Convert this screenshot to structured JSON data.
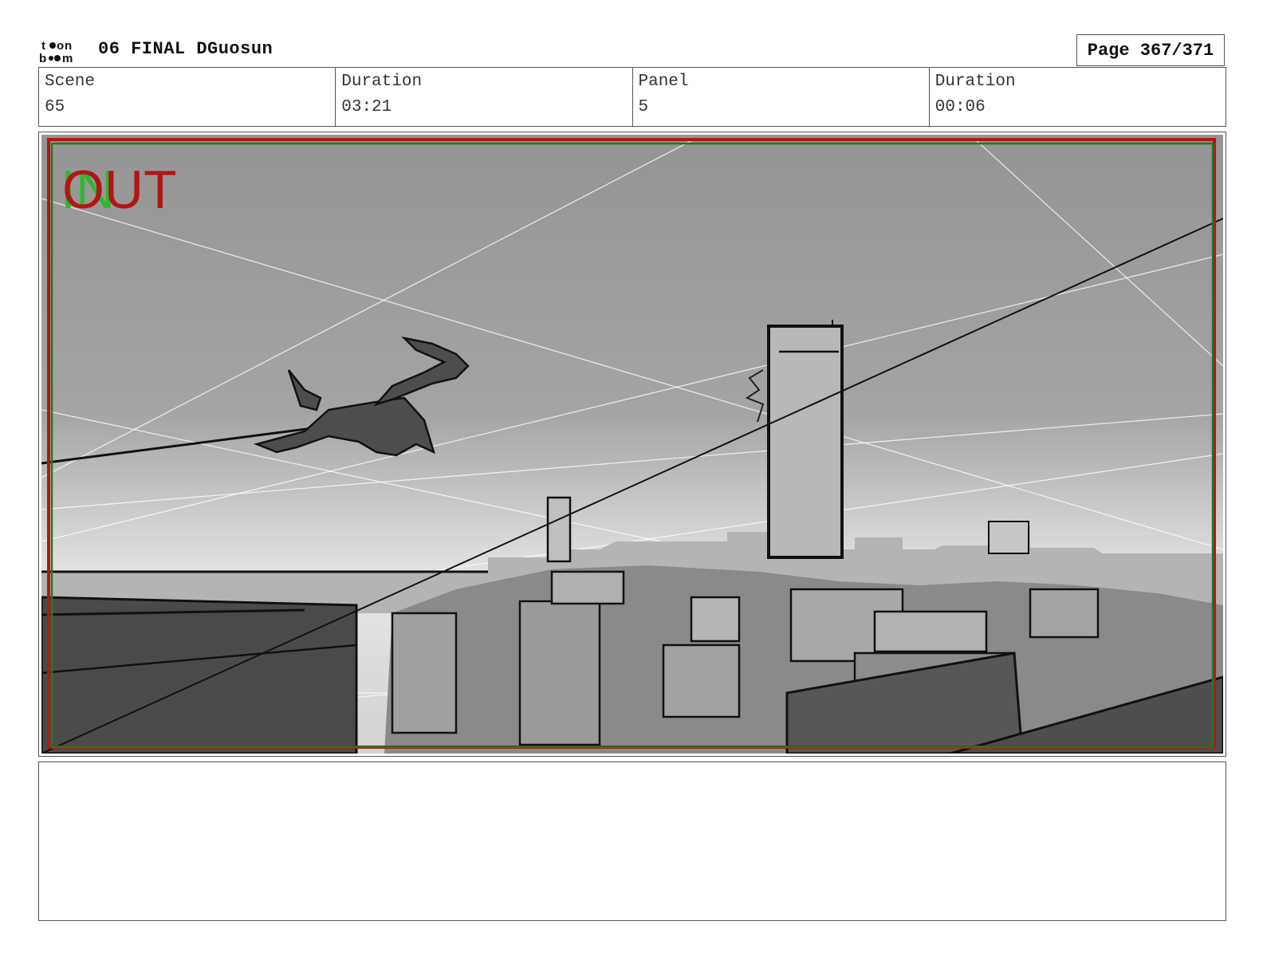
{
  "header": {
    "logo_text": "toon boom",
    "title": "06 FINAL DGuosun",
    "page": "Page 367/371"
  },
  "info": [
    {
      "label": "Scene",
      "value": "65"
    },
    {
      "label": "Duration",
      "value": "03:21"
    },
    {
      "label": "Panel",
      "value": "5"
    },
    {
      "label": "Duration",
      "value": "00:06"
    }
  ],
  "panel": {
    "in_marker": "IN",
    "out_marker": "OUT",
    "colors": {
      "in": "#2db82d",
      "out": "#b31515",
      "safe_frame": "#1e7a1e"
    }
  },
  "notes": {
    "text": ""
  }
}
